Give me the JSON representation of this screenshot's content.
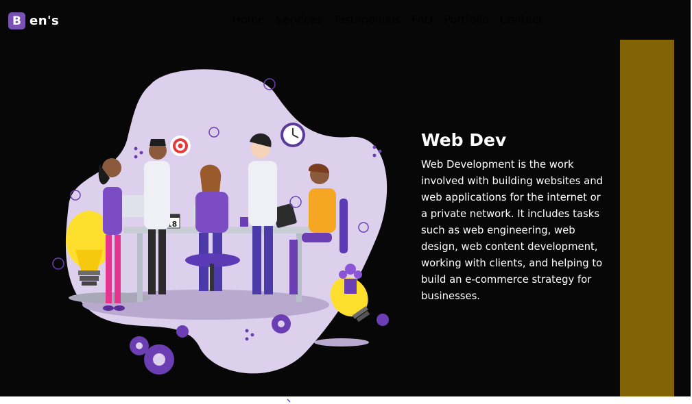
{
  "brand": {
    "logo_letter": "B",
    "name": "en's"
  },
  "nav": {
    "items": [
      {
        "label": "Home",
        "active": true
      },
      {
        "label": "Services",
        "active": false
      },
      {
        "label": "Testimonials",
        "active": false
      },
      {
        "label": "FAQ",
        "active": false
      },
      {
        "label": "Portfolio",
        "active": false
      },
      {
        "label": "Contact",
        "active": false
      }
    ]
  },
  "hero": {
    "title": "Web Dev",
    "body": "Web Development is the work involved with building websites and web applications for the internet or a private network. It includes tasks such as web engineering, web design, web content development, working with clients, and helping to build an e-commerce strategy for businesses.",
    "illustration": {
      "icon": "team-at-work-illustration",
      "calendar_day": "18"
    }
  },
  "colors": {
    "background": "#070707",
    "brand": "#7952b3",
    "accent_bar": "#826406",
    "nav_inactive": "#9a9a9a",
    "blob": "#ddd0ec"
  }
}
